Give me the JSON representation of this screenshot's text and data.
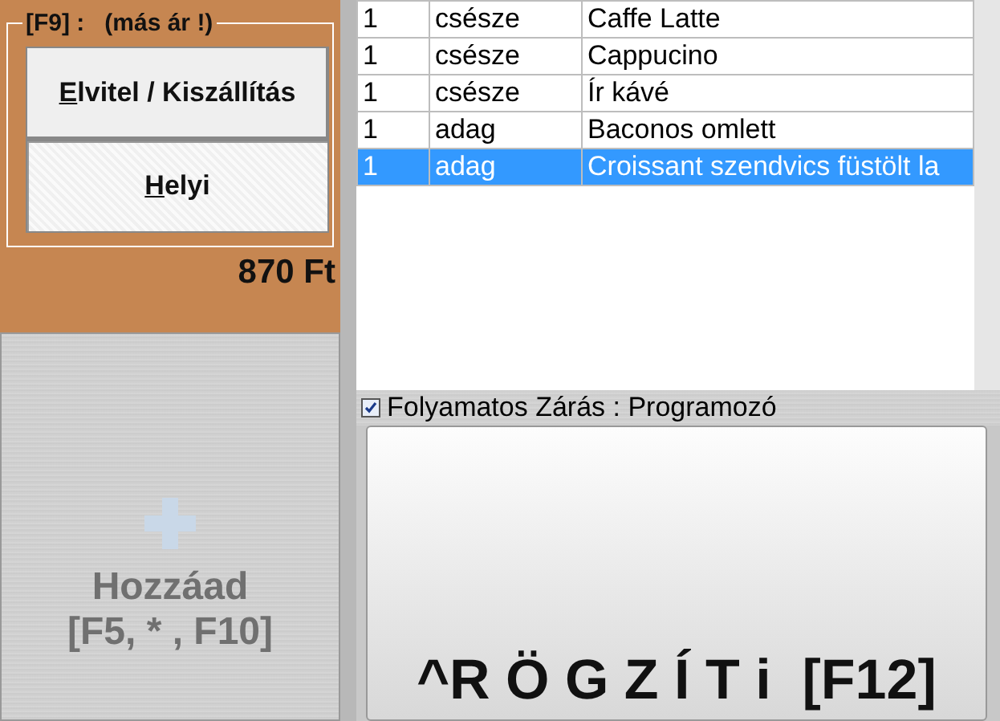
{
  "price_group": {
    "legend": "[F9] :   (más ár !)",
    "options": [
      {
        "label": "Elvitel / Kiszállítás",
        "selected": false
      },
      {
        "label": "Helyi",
        "selected": true
      }
    ]
  },
  "total": "870 Ft",
  "add_button": {
    "label": "Hozzáad",
    "shortcut": "[F5, * , F10]",
    "disabled": true
  },
  "order_table": {
    "rows": [
      {
        "qty": "1",
        "unit": "csésze",
        "name": "Caffe Latte",
        "selected": false
      },
      {
        "qty": "1",
        "unit": "csésze",
        "name": "Cappucino",
        "selected": false
      },
      {
        "qty": "1",
        "unit": "csésze",
        "name": "Ír kávé",
        "selected": false
      },
      {
        "qty": "1",
        "unit": "adag",
        "name": "Baconos omlett",
        "selected": false
      },
      {
        "qty": "1",
        "unit": "adag",
        "name": "Croissant szendvics füstölt la",
        "selected": true
      }
    ]
  },
  "continuous_close": {
    "label": "Folyamatos Zárás : Programozó",
    "checked": true
  },
  "save_button": {
    "label": "^R Ö G Z Í T i  [F12]"
  }
}
